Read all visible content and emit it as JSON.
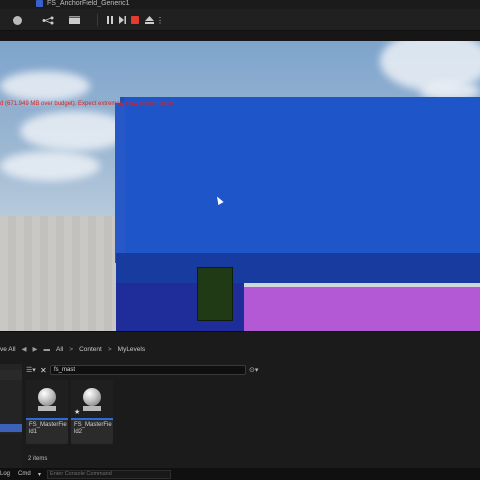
{
  "tab": {
    "title": "FS_AnchorField_Generic1"
  },
  "toolbar": {
    "more": "⋮"
  },
  "viewport": {
    "warning": "d (671.949 MB over budget). Expect extremely slow performance"
  },
  "content_browser": {
    "nav": {
      "save_all": "ve All",
      "root": "All",
      "content": "Content",
      "folder": "MyLevels",
      "sep": ">"
    },
    "search": {
      "value": "fs_mast"
    },
    "assets": [
      {
        "name": "FS_MasterField1"
      },
      {
        "name": "FS_MasterField2"
      }
    ],
    "item_count": "2 items"
  },
  "statusbar": {
    "log": "Log",
    "cmd": "Cmd",
    "console_placeholder": "Enter Console Command"
  },
  "colors": {
    "stop": "#e33b2f",
    "selection": "#2f6bd6",
    "wall_blue": "#1e55c9",
    "purple": "#b359d6"
  }
}
